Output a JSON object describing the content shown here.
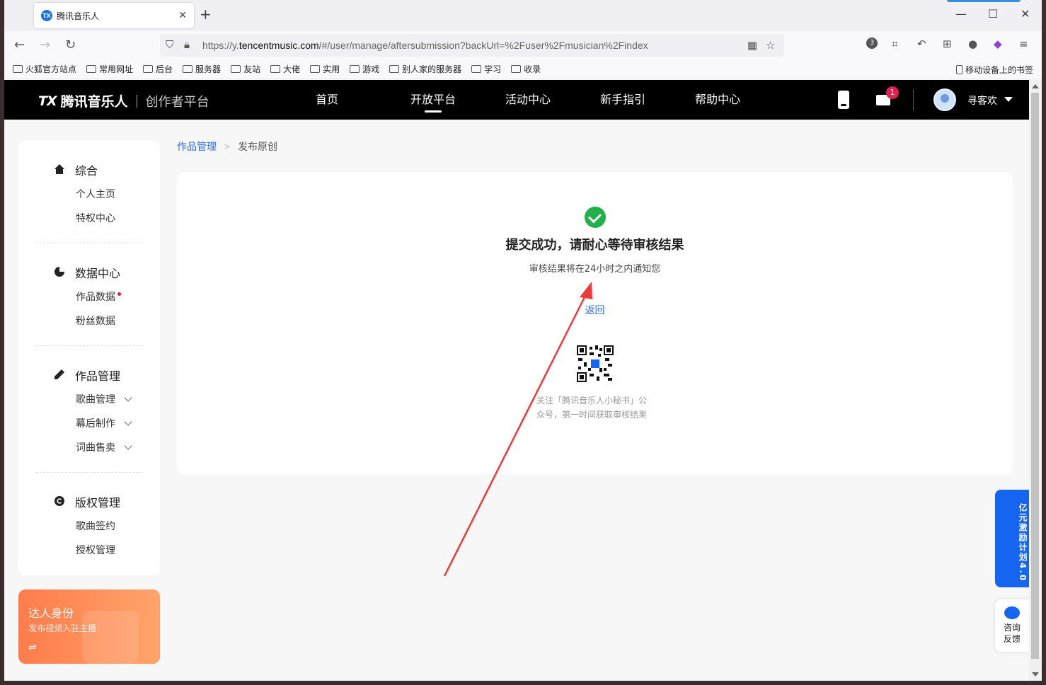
{
  "browser": {
    "tab_title": "腾讯音乐人",
    "favicon_text": "TX",
    "tab_close": "✕",
    "new_tab": "+",
    "url_prefix": "https://y.",
    "url_host": "tencentmusic.com",
    "url_path": "/#/user/manage/aftersubmission?backUrl=%2Fuser%2Fmusician%2Findex",
    "ext_badge": "3",
    "bookmarks": [
      "火狐官方站点",
      "常用网址",
      "后台",
      "服务器",
      "友站",
      "大佬",
      "实用",
      "游戏",
      "别人家的服务器",
      "学习",
      "收录"
    ],
    "mobile_bookmarks": "移动设备上的书签"
  },
  "header": {
    "logo_mark": "TX",
    "logo_name": "腾讯音乐人",
    "logo_sub": "创作者平台",
    "nav": [
      "首页",
      "开放平台",
      "活动中心",
      "新手指引",
      "帮助中心"
    ],
    "active_nav": "开放平台",
    "mail_badge": "1",
    "username": "寻客欢"
  },
  "sidebar": {
    "sections": [
      {
        "title": "综合",
        "items": [
          "个人主页",
          "特权中心"
        ]
      },
      {
        "title": "数据中心",
        "items": [
          "作品数据",
          "粉丝数据"
        ]
      },
      {
        "title": "作品管理",
        "items": [
          "歌曲管理",
          "幕后制作",
          "词曲售卖"
        ]
      },
      {
        "title": "版权管理",
        "items": [
          "歌曲签约",
          "授权管理"
        ]
      }
    ]
  },
  "talent_card": {
    "title": "达人身份",
    "subtitle": "发布视频入驻主播",
    "switch_icon": "⇌"
  },
  "breadcrumb": {
    "parent": "作品管理",
    "separator": ">",
    "current": "发布原创"
  },
  "result": {
    "title": "提交成功，请耐心等待审核结果",
    "subtitle": "审核结果将在24小时之内通知您",
    "back": "返回",
    "qr_caption": "关注「腾讯音乐人小秘书」公众号，第一时间获取审核结果"
  },
  "floating": {
    "promo": "亿元激励计划4.0",
    "feedback_line1": "咨询",
    "feedback_line2": "反馈"
  },
  "colors": {
    "accent_blue": "#2f6fd6",
    "success_green": "#21b04a",
    "badge_red": "#e0204f",
    "annotation_arrow": "#ee3a3a"
  }
}
